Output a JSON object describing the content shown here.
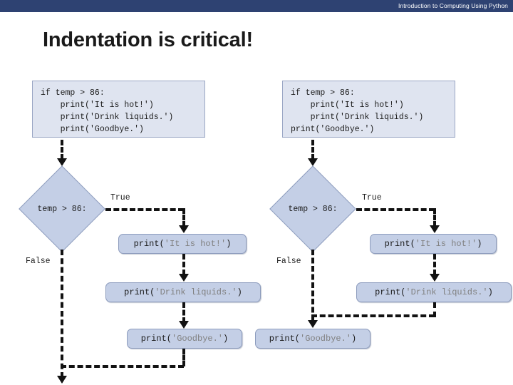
{
  "header": {
    "title": "Introduction to Computing Using Python"
  },
  "slide": {
    "title": "Indentation is critical!",
    "banner_color": "#2e4272",
    "shape_fill": "#c4cfe6",
    "code_fill": "#dfe4f0"
  },
  "code_blocks": [
    {
      "id": "left",
      "text": "if temp > 86:\n    print('It is hot!')\n    print('Drink liquids.')\n    print('Goodbye.')"
    },
    {
      "id": "right",
      "text": "if temp > 86:\n    print('It is hot!')\n    print('Drink liquids.')\nprint('Goodbye.')"
    }
  ],
  "flowcharts": [
    {
      "id": "left",
      "decision": "temp > 86:",
      "true_label": "True",
      "false_label": "False",
      "nodes": [
        {
          "call": "print(",
          "arg": "'It is hot!'",
          "close": ")"
        },
        {
          "call": "print(",
          "arg": "'Drink liquids.'",
          "close": ")"
        },
        {
          "call": "print(",
          "arg": "'Goodbye.'",
          "close": ")"
        }
      ]
    },
    {
      "id": "right",
      "decision": "temp > 86:",
      "true_label": "True",
      "false_label": "False",
      "nodes": [
        {
          "call": "print(",
          "arg": "'It is hot!'",
          "close": ")"
        },
        {
          "call": "print(",
          "arg": "'Drink liquids.'",
          "close": ")"
        },
        {
          "call": "print(",
          "arg": "'Goodbye.'",
          "close": ")"
        }
      ]
    }
  ]
}
